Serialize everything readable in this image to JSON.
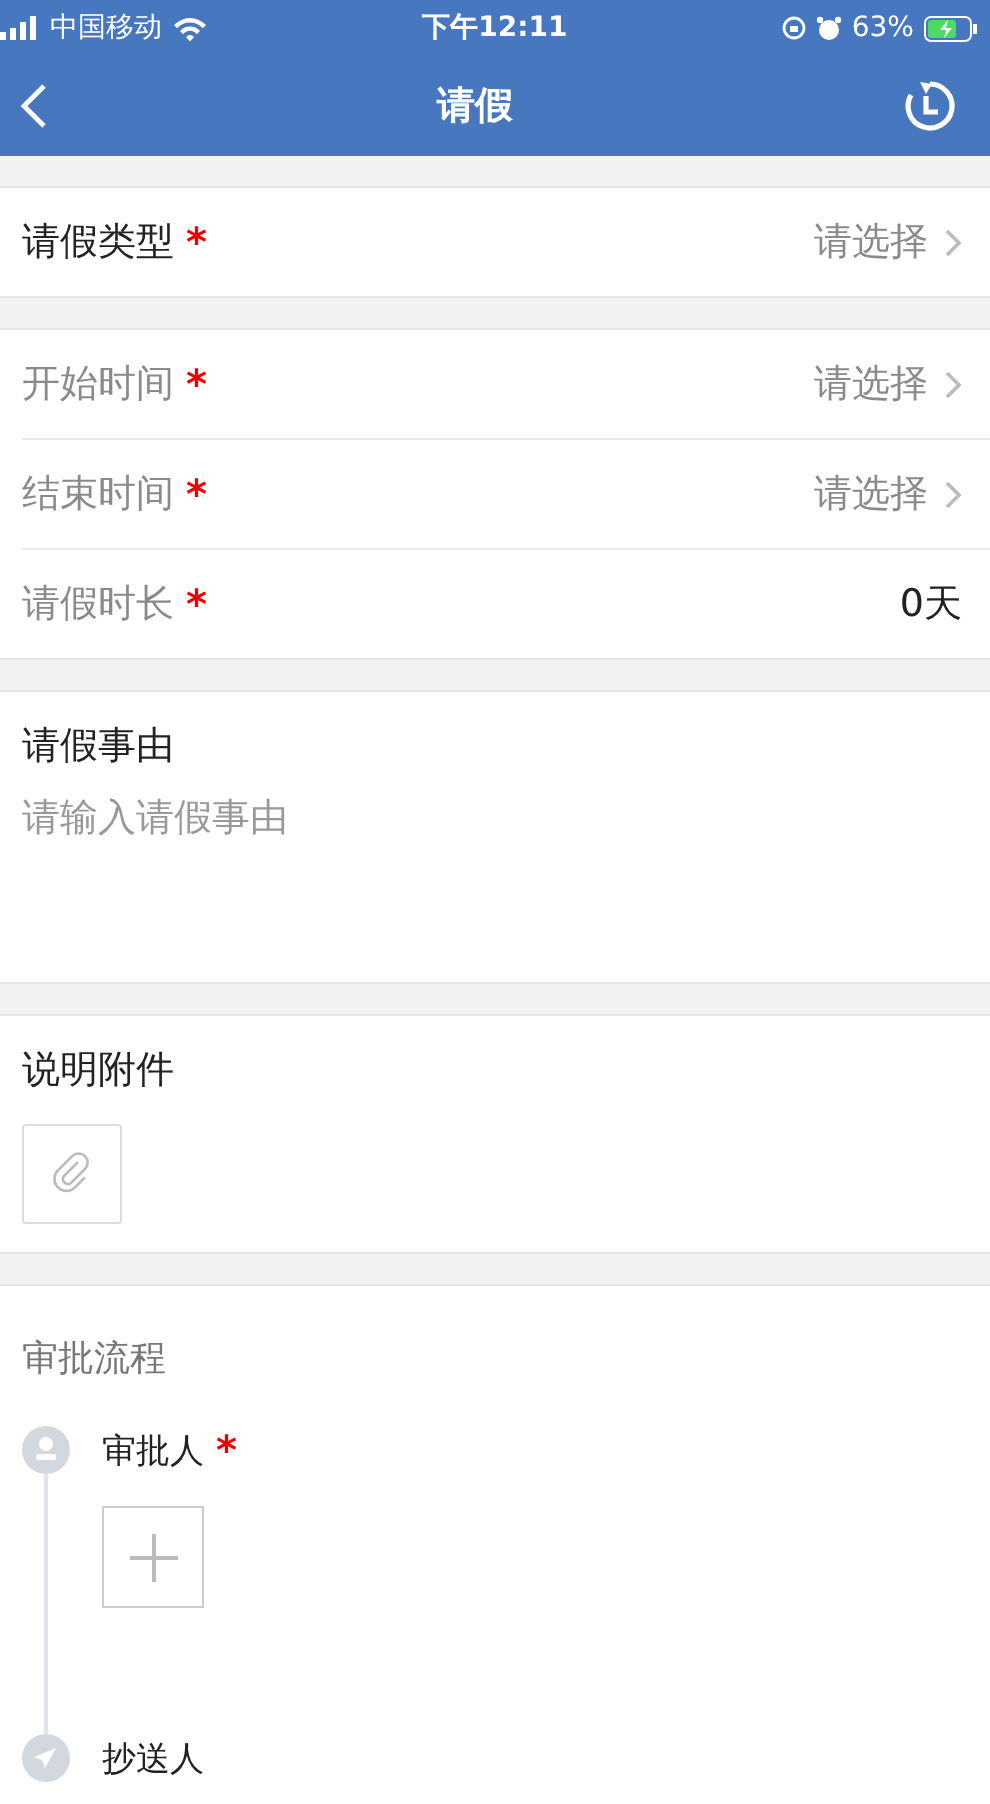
{
  "status_bar": {
    "carrier": "中国移动",
    "time": "下午12:11",
    "battery": "63%"
  },
  "nav": {
    "title": "请假"
  },
  "groups": [
    {
      "rows": [
        {
          "kind": "select",
          "label": "请假类型",
          "required_mark": "*",
          "dimmed": false,
          "placeholder": "请选择"
        }
      ]
    },
    {
      "rows": [
        {
          "kind": "select",
          "label": "开始时间",
          "required_mark": "*",
          "dimmed": true,
          "placeholder": "请选择"
        },
        {
          "kind": "select",
          "label": "结束时间",
          "required_mark": "*",
          "dimmed": true,
          "placeholder": "请选择"
        },
        {
          "kind": "display",
          "label": "请假时长",
          "required_mark": "*",
          "dimmed": true,
          "value": "0天"
        }
      ]
    }
  ],
  "reason": {
    "title": "请假事由",
    "placeholder": "请输入请假事由"
  },
  "attachment": {
    "title": "说明附件"
  },
  "approval": {
    "title": "审批流程",
    "steps": [
      {
        "kind": "approver",
        "label": "审批人",
        "required_mark": "*"
      },
      {
        "kind": "cc",
        "label": "抄送人"
      }
    ]
  }
}
